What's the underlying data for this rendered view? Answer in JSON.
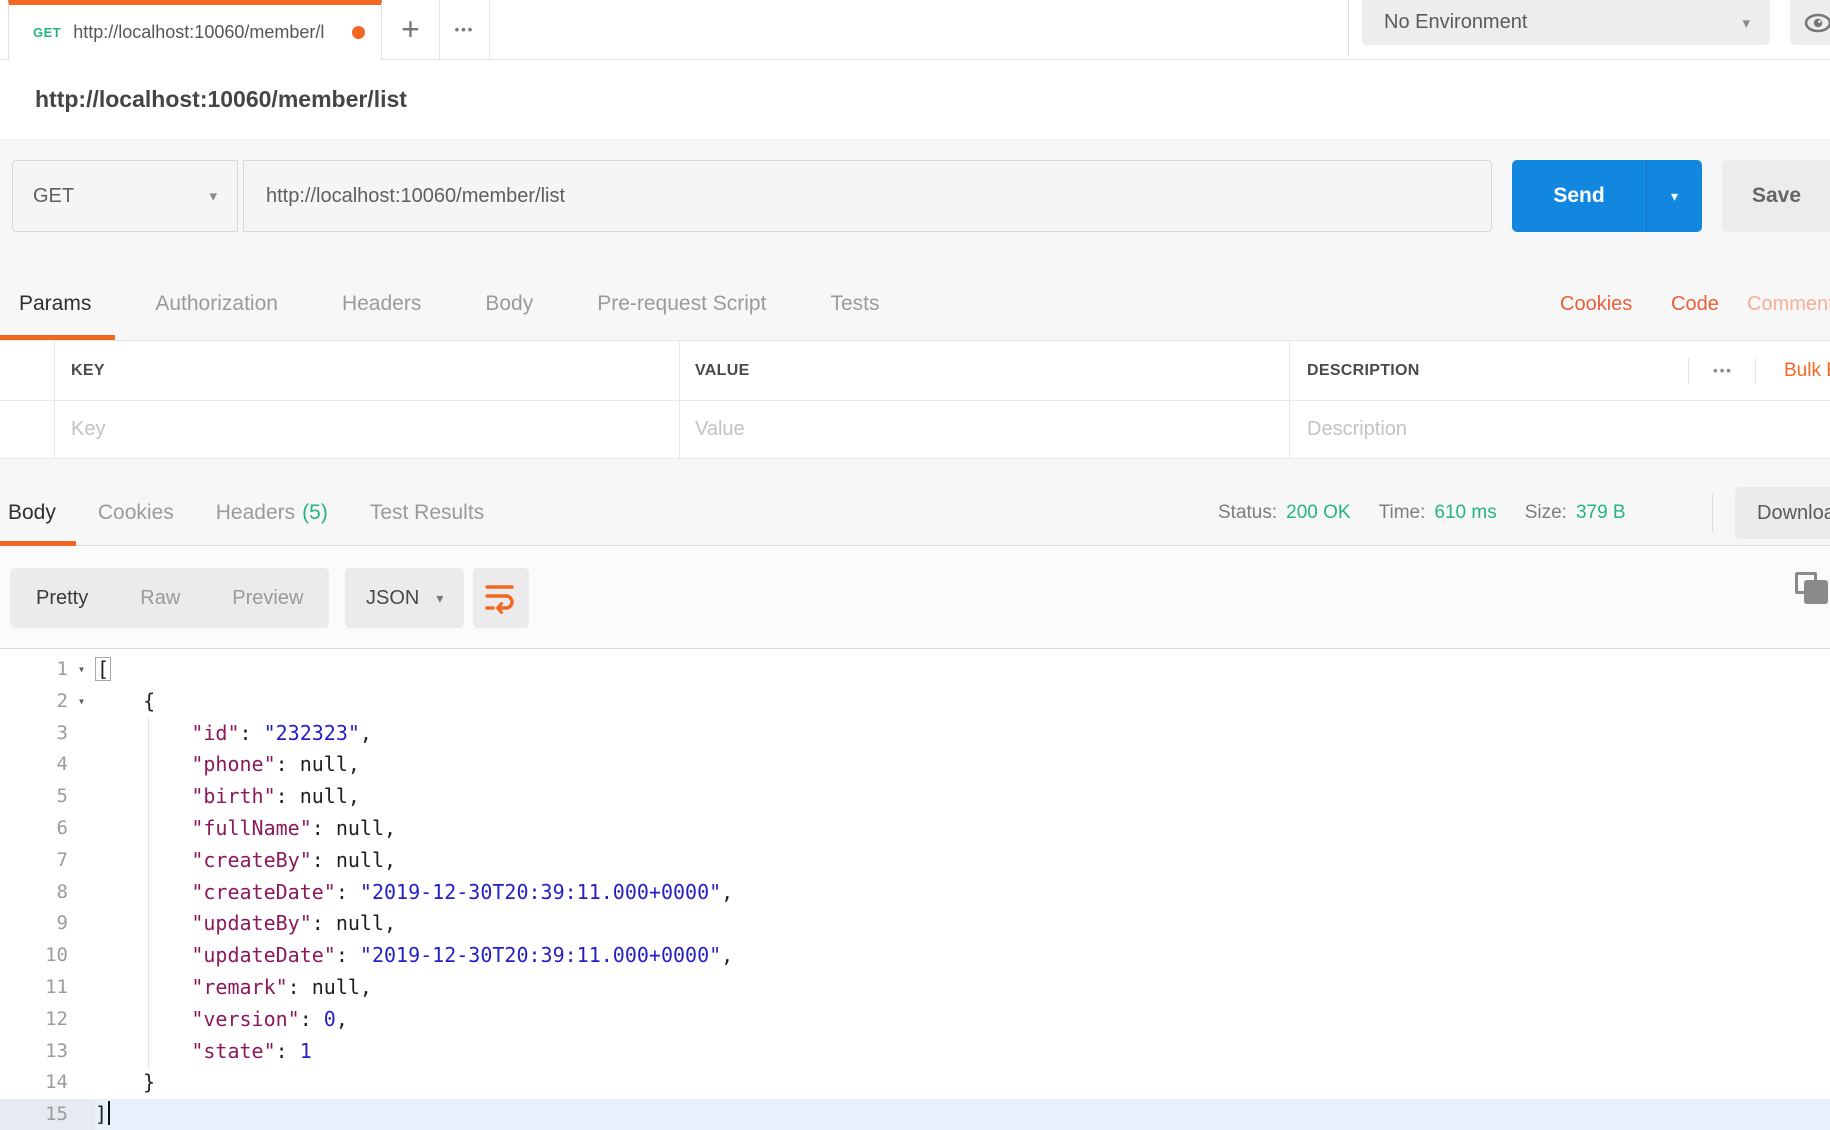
{
  "colors": {
    "accent_orange": "#F26722",
    "send_blue": "#1287E0",
    "success_green": "#26B47F",
    "link_orange": "#E8603A",
    "syntax_key": "#8C195A",
    "syntax_value": "#241FC4",
    "active_line_bg": "#E7F1FB"
  },
  "icons": {
    "plus": "+",
    "more_dots": "•••",
    "menu_dots": "•••",
    "chevron_down": "▾",
    "fold": "▾"
  },
  "tab": {
    "method": "GET",
    "title": "http://localhost:10060/member/l"
  },
  "environment": {
    "selected": "No Environment"
  },
  "request": {
    "title": "http://localhost:10060/member/list",
    "method": "GET",
    "url": "http://localhost:10060/member/list",
    "send_label": "Send",
    "save_label": "Save",
    "tabs": [
      "Params",
      "Authorization",
      "Headers",
      "Body",
      "Pre-request Script",
      "Tests"
    ],
    "active_tab": "Params",
    "links": {
      "cookies": "Cookies",
      "code": "Code",
      "comments": "Comments"
    }
  },
  "params_table": {
    "columns": {
      "key": "KEY",
      "value": "VALUE",
      "description": "DESCRIPTION"
    },
    "placeholders": {
      "key": "Key",
      "value": "Value",
      "description": "Description"
    },
    "bulk_edit": "Bulk Edit"
  },
  "response": {
    "tabs": {
      "body": "Body",
      "cookies": "Cookies",
      "headers": "Headers",
      "headers_count": "(5)",
      "tests": "Test Results"
    },
    "active_tab": "Body",
    "status_label": "Status:",
    "status": "200 OK",
    "time_label": "Time:",
    "time": "610 ms",
    "size_label": "Size:",
    "size": "379 B",
    "download_label": "Download",
    "view_modes": [
      "Pretty",
      "Raw",
      "Preview"
    ],
    "active_mode": "Pretty",
    "language": "JSON",
    "body_json": [
      {
        "id": "232323",
        "phone": null,
        "birth": null,
        "fullName": null,
        "createBy": null,
        "createDate": "2019-12-30T20:39:11.000+0000",
        "updateBy": null,
        "updateDate": "2019-12-30T20:39:11.000+0000",
        "remark": null,
        "version": 0,
        "state": 1
      }
    ],
    "body_lines": [
      {
        "n": 1,
        "fold": true,
        "tokens": [
          [
            "b",
            "["
          ]
        ]
      },
      {
        "n": 2,
        "fold": true,
        "tokens": [
          [
            "p",
            "    {"
          ]
        ]
      },
      {
        "n": 3,
        "tokens": [
          [
            "p",
            "        "
          ],
          [
            "k",
            "\"id\""
          ],
          [
            "p",
            ": "
          ],
          [
            "s",
            "\"232323\""
          ],
          [
            "p",
            ","
          ]
        ]
      },
      {
        "n": 4,
        "tokens": [
          [
            "p",
            "        "
          ],
          [
            "k",
            "\"phone\""
          ],
          [
            "p",
            ": null,"
          ]
        ]
      },
      {
        "n": 5,
        "tokens": [
          [
            "p",
            "        "
          ],
          [
            "k",
            "\"birth\""
          ],
          [
            "p",
            ": null,"
          ]
        ]
      },
      {
        "n": 6,
        "tokens": [
          [
            "p",
            "        "
          ],
          [
            "k",
            "\"fullName\""
          ],
          [
            "p",
            ": null,"
          ]
        ]
      },
      {
        "n": 7,
        "tokens": [
          [
            "p",
            "        "
          ],
          [
            "k",
            "\"createBy\""
          ],
          [
            "p",
            ": null,"
          ]
        ]
      },
      {
        "n": 8,
        "tokens": [
          [
            "p",
            "        "
          ],
          [
            "k",
            "\"createDate\""
          ],
          [
            "p",
            ": "
          ],
          [
            "s",
            "\"2019-12-30T20:39:11.000+0000\""
          ],
          [
            "p",
            ","
          ]
        ]
      },
      {
        "n": 9,
        "tokens": [
          [
            "p",
            "        "
          ],
          [
            "k",
            "\"updateBy\""
          ],
          [
            "p",
            ": null,"
          ]
        ]
      },
      {
        "n": 10,
        "tokens": [
          [
            "p",
            "        "
          ],
          [
            "k",
            "\"updateDate\""
          ],
          [
            "p",
            ": "
          ],
          [
            "s",
            "\"2019-12-30T20:39:11.000+0000\""
          ],
          [
            "p",
            ","
          ]
        ]
      },
      {
        "n": 11,
        "tokens": [
          [
            "p",
            "        "
          ],
          [
            "k",
            "\"remark\""
          ],
          [
            "p",
            ": null,"
          ]
        ]
      },
      {
        "n": 12,
        "tokens": [
          [
            "p",
            "        "
          ],
          [
            "k",
            "\"version\""
          ],
          [
            "p",
            ": "
          ],
          [
            "n2",
            "0"
          ],
          [
            "p",
            ","
          ]
        ]
      },
      {
        "n": 13,
        "tokens": [
          [
            "p",
            "        "
          ],
          [
            "k",
            "\"state\""
          ],
          [
            "p",
            ": "
          ],
          [
            "n2",
            "1"
          ]
        ]
      },
      {
        "n": 14,
        "tokens": [
          [
            "p",
            "    }"
          ]
        ]
      },
      {
        "n": 15,
        "active": true,
        "caret": true,
        "tokens": [
          [
            "p",
            "]"
          ]
        ]
      }
    ]
  }
}
